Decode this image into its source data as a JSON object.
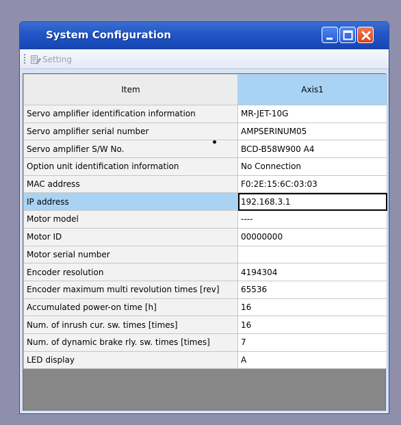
{
  "window": {
    "title": "System Configuration"
  },
  "toolbar": {
    "setting_label": "Setting"
  },
  "table": {
    "headers": {
      "item": "Item",
      "axis": "Axis1"
    },
    "rows": [
      {
        "item": "Servo amplifier identification information",
        "value": "MR-JET-10G"
      },
      {
        "item": "Servo amplifier serial number",
        "value": "AMPSERINUM05"
      },
      {
        "item": "Servo amplifier S/W No.",
        "value": "BCD-B58W900 A4"
      },
      {
        "item": "Option unit identification information",
        "value": "No Connection"
      },
      {
        "item": "MAC address",
        "value": "F0:2E:15:6C:03:03"
      },
      {
        "item": "IP address",
        "value": "192.168.3.1"
      },
      {
        "item": "Motor model",
        "value": "----"
      },
      {
        "item": "Motor ID",
        "value": "00000000"
      },
      {
        "item": "Motor serial number",
        "value": ""
      },
      {
        "item": "Encoder resolution",
        "value": "4194304"
      },
      {
        "item": "Encoder maximum multi revolution times [rev]",
        "value": "65536"
      },
      {
        "item": "Accumulated power-on time [h]",
        "value": "16"
      },
      {
        "item": "Num. of inrush cur. sw. times [times]",
        "value": "16"
      },
      {
        "item": "Num. of dynamic brake rly. sw. times [times]",
        "value": "7"
      },
      {
        "item": "LED display",
        "value": "A"
      }
    ]
  },
  "icons": {
    "setting": "setting-icon",
    "minimize": "minimize-icon",
    "maximize": "maximize-icon",
    "close": "close-icon"
  }
}
